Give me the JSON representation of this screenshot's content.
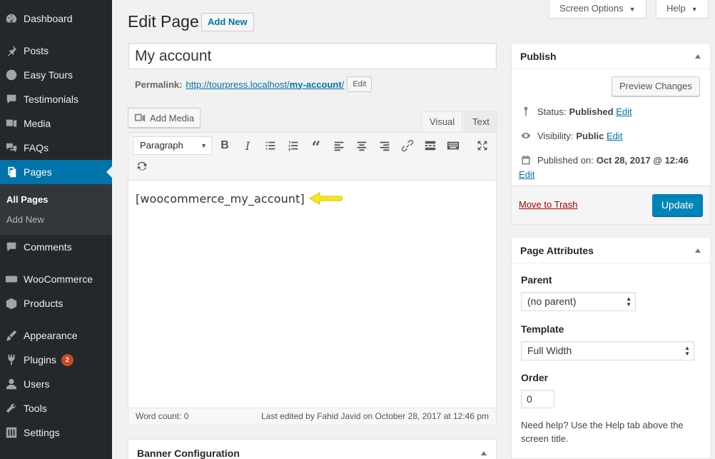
{
  "sidebar": {
    "items": [
      {
        "label": "Dashboard",
        "icon": "dashboard-icon"
      },
      {
        "label": "Posts",
        "icon": "pin-icon"
      },
      {
        "label": "Easy Tours",
        "icon": "globe-icon"
      },
      {
        "label": "Testimonials",
        "icon": "comment-lines-icon"
      },
      {
        "label": "Media",
        "icon": "media-icon"
      },
      {
        "label": "FAQs",
        "icon": "chat-bubbles-icon"
      },
      {
        "label": "Pages",
        "icon": "pages-icon",
        "active": true
      },
      {
        "label": "Comments",
        "icon": "comment-icon"
      },
      {
        "label": "WooCommerce",
        "icon": "woo-icon"
      },
      {
        "label": "Products",
        "icon": "box-icon"
      },
      {
        "label": "Appearance",
        "icon": "brush-icon"
      },
      {
        "label": "Plugins",
        "icon": "plug-icon",
        "badge": "2"
      },
      {
        "label": "Users",
        "icon": "user-icon"
      },
      {
        "label": "Tools",
        "icon": "wrench-icon"
      },
      {
        "label": "Settings",
        "icon": "settings-icon"
      }
    ],
    "submenu": {
      "all_pages": "All Pages",
      "add_new": "Add New"
    }
  },
  "header": {
    "title": "Edit Page",
    "add_new": "Add New",
    "screen_options": "Screen Options",
    "help": "Help"
  },
  "post": {
    "title": "My account",
    "permalink_label": "Permalink:",
    "permalink_base": "http://tourpress.localhost/",
    "permalink_slug": "my-account",
    "permalink_trailing": "/",
    "permalink_edit": "Edit"
  },
  "editor": {
    "add_media": "Add Media",
    "tab_visual": "Visual",
    "tab_text": "Text",
    "format": "Paragraph",
    "content": "[woocommerce_my_account]",
    "word_count": "Word count: 0",
    "last_edited": "Last edited by Fahid Javid on October 28, 2017 at 12:46 pm"
  },
  "publish": {
    "title": "Publish",
    "preview": "Preview Changes",
    "status_label": "Status:",
    "status_value": "Published",
    "visibility_label": "Visibility:",
    "visibility_value": "Public",
    "published_label": "Published on:",
    "published_value": "Oct 28, 2017 @ 12:46",
    "edit": "Edit",
    "trash": "Move to Trash",
    "update": "Update"
  },
  "attributes": {
    "title": "Page Attributes",
    "parent_label": "Parent",
    "parent_value": "(no parent)",
    "template_label": "Template",
    "template_value": "Full Width",
    "order_label": "Order",
    "order_value": "0",
    "help": "Need help? Use the Help tab above the screen title."
  },
  "banner": {
    "title": "Banner Configuration"
  },
  "colors": {
    "accent": "#0073aa",
    "sidebar": "#23282d",
    "annotation": "#f5e71e"
  }
}
